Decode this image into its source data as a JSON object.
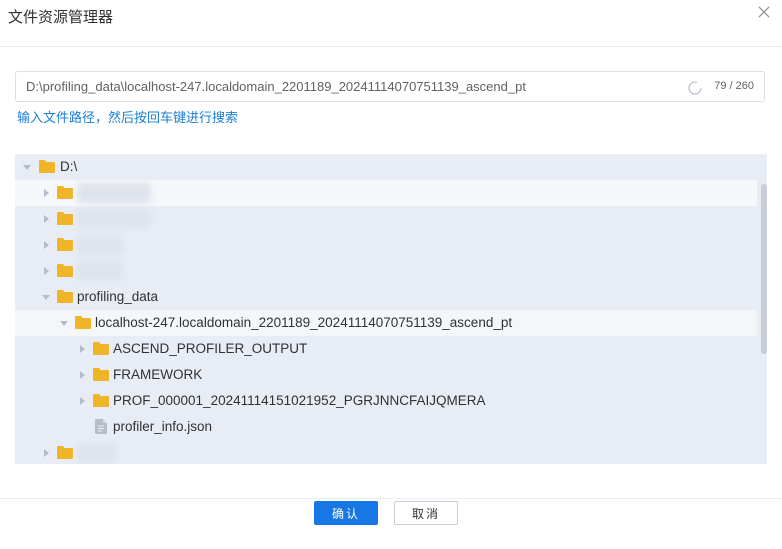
{
  "dialog": {
    "title": "文件资源管理器",
    "path_value": "D:\\profiling_data\\localhost-247.localdomain_2201189_20241114070751139_ascend_pt",
    "counter": "79 / 260",
    "hint": "输入文件路径，然后按回车键进行搜索"
  },
  "tree": {
    "root": "D:\\",
    "profiling": "profiling_data",
    "localhost": "localhost-247.localdomain_2201189_20241114070751139_ascend_pt",
    "items": [
      "ASCEND_PROFILER_OUTPUT",
      "FRAMEWORK",
      "PROF_000001_20241114151021952_PGRJNNCFAIJQMERA"
    ],
    "file": "profiler_info.json"
  },
  "buttons": {
    "ok": "确认",
    "cancel": "取消"
  },
  "colors": {
    "accent": "#1677e5",
    "hint": "#1a7fd6",
    "folder": "#f0b429"
  }
}
